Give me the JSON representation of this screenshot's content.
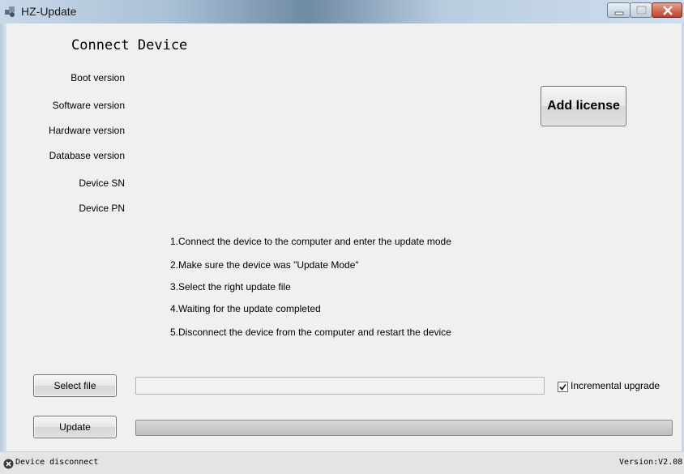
{
  "window": {
    "title": "HZ-Update",
    "icon": "app-icon",
    "controls": [
      "minimize-icon",
      "maximize-icon",
      "close-icon"
    ]
  },
  "device": {
    "heading": "Connect Device",
    "labels": [
      "Boot   version",
      "Software version",
      "Hardware version",
      "Database version",
      "Device SN",
      "Device PN"
    ]
  },
  "license_button": "Add license",
  "instructions": [
    "1.Connect the device to the computer and enter the update mode",
    "2.Make sure the device was \"Update Mode\"",
    "3.Select the right update file",
    "4.Waiting for the update completed",
    "5.Disconnect the device from the computer and restart the device"
  ],
  "file": {
    "select_button": "Select file",
    "path_value": "",
    "incremental_label": "Incremental upgrade",
    "incremental_checked": true
  },
  "update": {
    "button": "Update",
    "progress_fraction": 1.0
  },
  "status": {
    "icon": "disconnected-x-icon",
    "text": "Device disconnect",
    "version": "Version:V2.08"
  },
  "colors": {
    "window_bg": "#f0f0f0",
    "status_bar_bg": "#e4e4e4"
  }
}
